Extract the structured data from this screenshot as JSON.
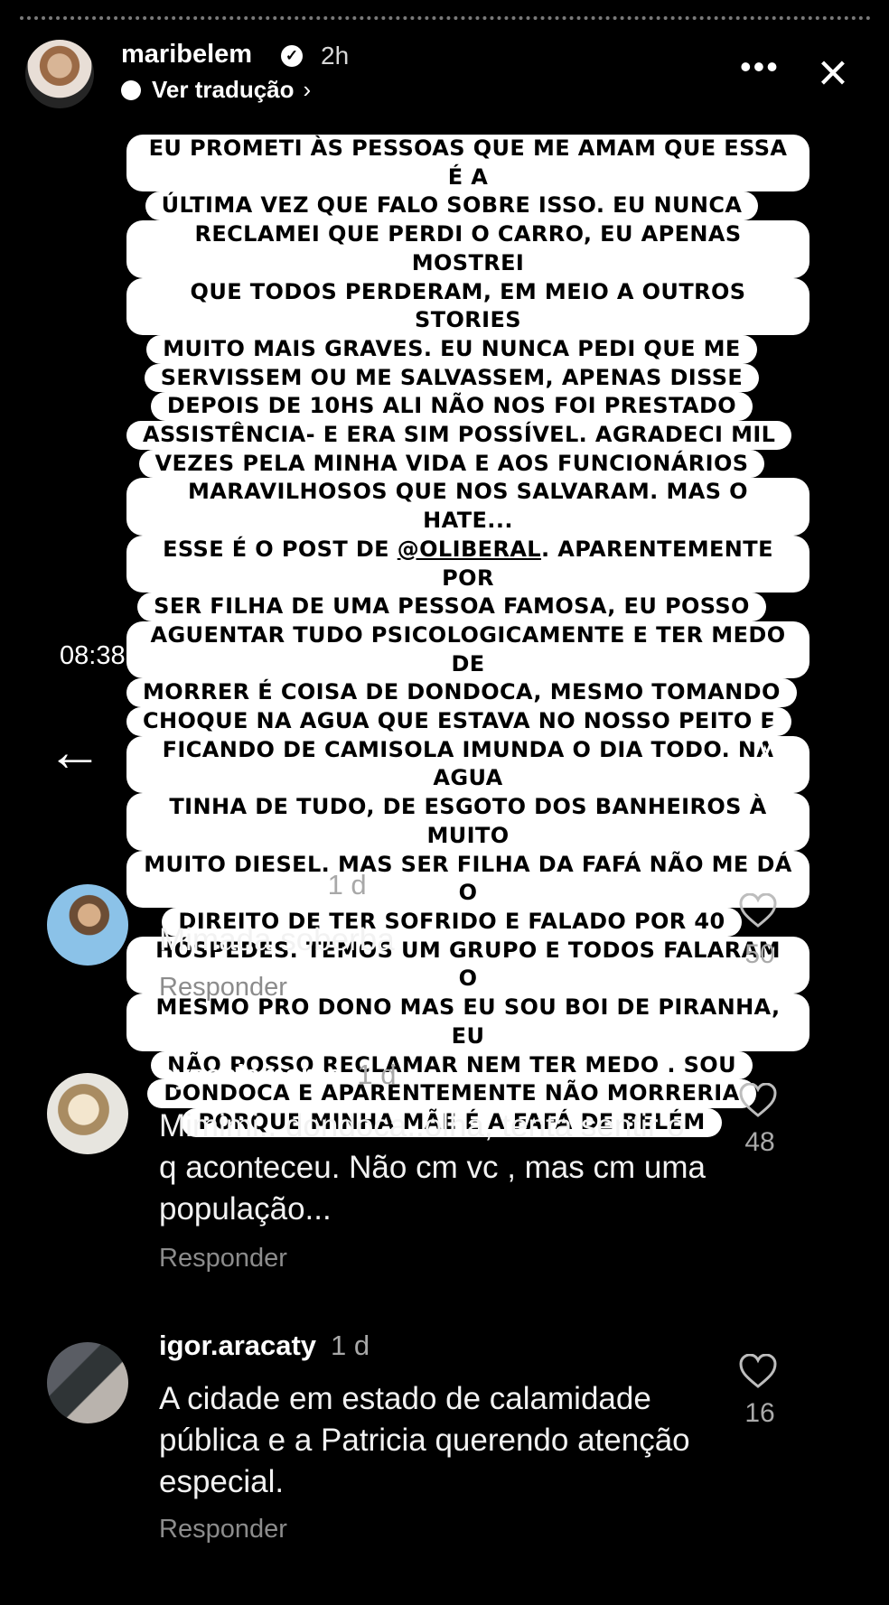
{
  "story": {
    "username": "maribelem",
    "posted": "2h",
    "translation": "Ver tradução",
    "time": "08:38",
    "lines_before_mention": [
      "EU PROMETI ÀS PESSOAS QUE ME AMAM QUE ESSA É A",
      "ÚLTIMA VEZ QUE FALO SOBRE ISSO. EU NUNCA",
      "RECLAMEI QUE PERDI O CARRO, EU APENAS MOSTREI",
      "QUE TODOS PERDERAM, EM MEIO A OUTROS STORIES",
      "MUITO MAIS GRAVES. EU NUNCA PEDI QUE ME",
      "SERVISSEM OU ME SALVASSEM, APENAS DISSE",
      "DEPOIS DE 10HS ALI NÃO NOS FOI PRESTADO",
      "ASSISTÊNCIA- E ERA SIM POSSÍVEL. AGRADECI MIL",
      "VEZES PELA MINHA VIDA E AOS FUNCIONÁRIOS",
      "MARAVILHOSOS QUE NOS SALVARAM. MAS O HATE..."
    ],
    "mention_line": {
      "before": "ESSE É O POST DE ",
      "mention": "@OLIBERAL",
      "after": ". APARENTEMENTE POR"
    },
    "lines_after_mention": [
      "SER FILHA DE UMA PESSOA FAMOSA, EU POSSO",
      "AGUENTAR TUDO PSICOLOGICAMENTE E TER MEDO DE",
      "MORRER É COISA DE DONDOCA, MESMO TOMANDO",
      "CHOQUE NA AGUA QUE ESTAVA NO NOSSO PEITO E",
      "FICANDO DE CAMISOLA IMUNDA O DIA TODO. NA AGUA",
      "TINHA DE TUDO, DE ESGOTO DOS BANHEIROS À MUITO",
      "MUITO DIESEL. MAS SER FILHA DA FAFÁ NÃO ME DÁ O",
      "DIREITO DE TER SOFRIDO E FALADO POR 40",
      "HÓSPEDES. TEMOS UM GRUPO E TODOS FALARAM O",
      "MESMO PRO DONO  MAS EU SOU BOI DE PIRANHA, EU",
      "NÃO POSSO RECLAMAR NEM TER MEDO . SOU",
      "DONDOCA E APARENTEMENTE NÃO MORRERIA",
      "PORQUE MINHA MÃE É A FAFÁ DE BELÉM"
    ]
  },
  "comments": [
    {
      "user": "andreereiro",
      "time": "1 d",
      "text": "Mimada soberba",
      "likes": "50",
      "reply": "Responder"
    },
    {
      "user": "syssalamarca",
      "time": "1 d",
      "text": "Mimimi.. dondoca..olha, tenta sentir o q aconteceu. Não cm vc , mas cm uma população...",
      "likes": "48",
      "reply": "Responder"
    },
    {
      "user": "igor.aracaty",
      "time": "1 d",
      "text": "A cidade em estado de calamidade pública e a Patricia querendo atenção especial.",
      "likes": "16",
      "reply": "Responder"
    }
  ],
  "icons": {
    "verified": "verified-icon",
    "more": "more-icon",
    "close": "close-icon",
    "back": "back-arrow-icon",
    "send": "send-icon",
    "heart": "heart-icon"
  }
}
